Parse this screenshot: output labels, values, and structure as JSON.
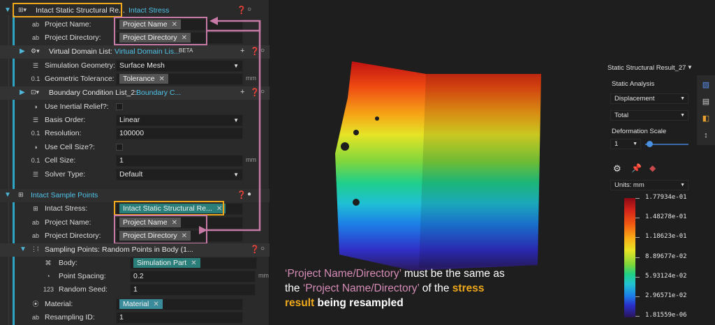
{
  "left_panel": {
    "section1": {
      "title": "Intact Static Structural Re...",
      "link": "Intact Stress",
      "rows": {
        "project_name_label": "Project Name:",
        "project_name_value": "Project Name",
        "project_dir_label": "Project Directory:",
        "project_dir_value": "Project Directory"
      },
      "virtual_domain": {
        "title": "Virtual Domain List:",
        "link": "Virtual Domain Lis...",
        "badge": "BETA"
      },
      "simulation_geometry": {
        "label": "Simulation Geometry:",
        "value": "Surface Mesh"
      },
      "geometric_tolerance": {
        "label": "Geometric Tolerance:",
        "value": "Tolerance",
        "unit": "mm"
      },
      "boundary": {
        "title": "Boundary Condition List_2:",
        "link": "Boundary C..."
      },
      "inertial_relief": {
        "label": "Use Inertial Relief?:"
      },
      "basis_order": {
        "label": "Basis Order:",
        "value": "Linear"
      },
      "resolution": {
        "label": "Resolution:",
        "value": "100000"
      },
      "use_cell_size": {
        "label": "Use Cell Size?:"
      },
      "cell_size": {
        "label": "Cell Size:",
        "value": "1",
        "unit": "mm"
      },
      "solver_type": {
        "label": "Solver Type:",
        "value": "Default"
      }
    },
    "section2": {
      "title": "Intact Sample Points",
      "intact_stress": {
        "label": "Intact Stress:",
        "value": "Intact Static Structural Re..."
      },
      "project_name": {
        "label": "Project Name:",
        "value": "Project Name"
      },
      "project_dir": {
        "label": "Project Directory:",
        "value": "Project Directory"
      },
      "sampling_points": {
        "label": "Sampling Points:",
        "value": "Random Points in Body (1..."
      },
      "body": {
        "label": "Body:",
        "value": "Simulation Part"
      },
      "point_spacing": {
        "label": "Point Spacing:",
        "value": "0.2",
        "unit": "mm"
      },
      "random_seed": {
        "label": "Random Seed:",
        "value": "1"
      },
      "material": {
        "label": "Material:",
        "value": "Material"
      },
      "resampling_id": {
        "label": "Resampling ID:",
        "value": "1"
      }
    },
    "icons": {
      "text": "ab",
      "number": "0.1",
      "int": "123"
    }
  },
  "caption": {
    "part1": "‘Project Name/Directory’",
    "part2": " must be the same as the ",
    "part3": "‘Project Name/Directory’",
    "part4": " of the ",
    "part5": "stress result",
    "part6": " being resampled"
  },
  "right_panel": {
    "title": "Static Structural Result_27",
    "analysis_label": "Static Analysis",
    "analysis_value": "Displacement",
    "component_value": "Total",
    "deformation_label": "Deformation Scale",
    "deformation_value": "1",
    "units_value": "Units: mm"
  },
  "colorbar": {
    "labels": [
      "1.77934e-01",
      "1.48278e-01",
      "1.18623e-01",
      "8.89677e-02",
      "5.93124e-02",
      "2.96571e-02",
      "1.81559e-06"
    ]
  },
  "colors": {
    "highlight_orange": "#f0a91c",
    "highlight_pink": "#c87aa6",
    "accent": "#4fc3e8"
  }
}
